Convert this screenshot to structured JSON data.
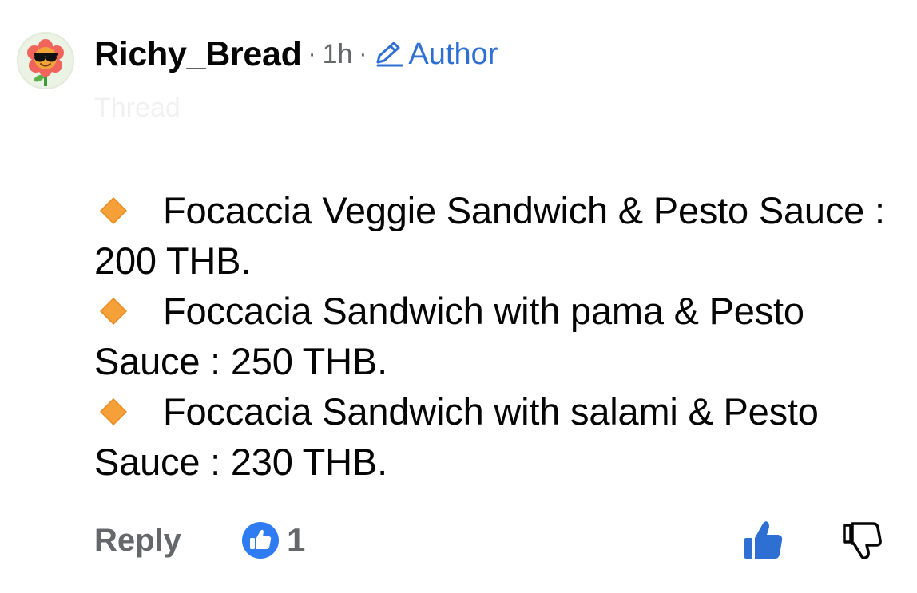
{
  "comment": {
    "username": "Richy_Bread",
    "separator": "·",
    "time": "1h",
    "author_badge": "Author",
    "faded_tag": "Thread",
    "lines": [
      "Focaccia Veggie Sandwich & Pesto Sauce : 200 THB.",
      "Foccacia Sandwich with pama & Pesto Sauce : 250 THB.",
      "Foccacia Sandwich with salami & Pesto Sauce : 230 THB."
    ],
    "bullet_icon": "orange-diamond-icon"
  },
  "actions": {
    "reply_label": "Reply",
    "reaction_count": "1",
    "reaction_icon": "like-reaction-icon",
    "like_icon": "thumbs-up-icon",
    "dislike_icon": "thumbs-down-icon"
  },
  "colors": {
    "accent_blue": "#2e6fd4",
    "like_blue": "#2e6fd4",
    "muted_gray": "#65676b",
    "diamond_orange": "#f6a03a"
  }
}
